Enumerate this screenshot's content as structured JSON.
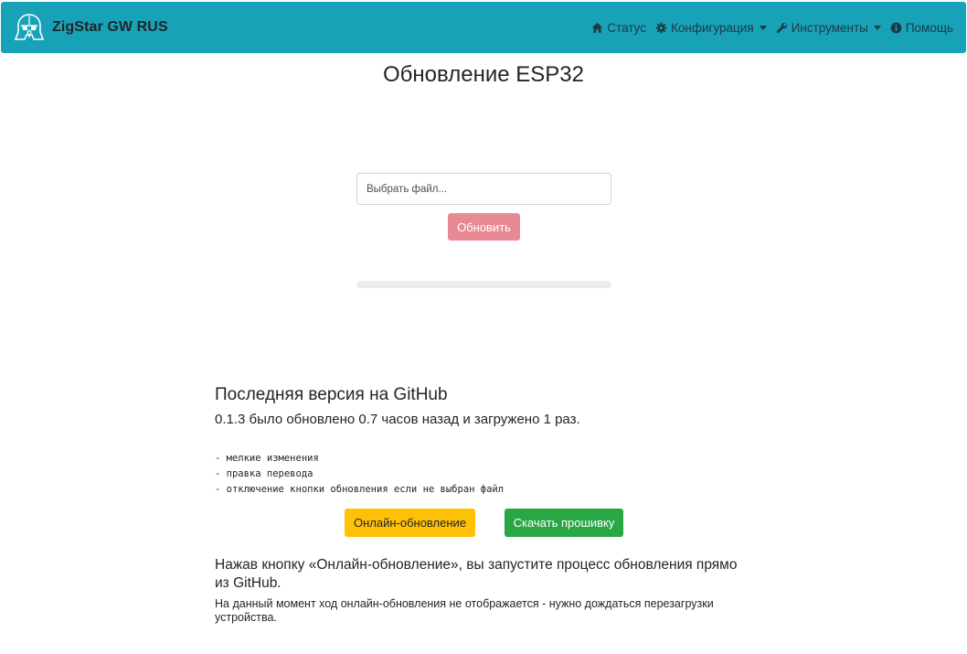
{
  "navbar": {
    "brand": "ZigStar GW RUS",
    "items": [
      {
        "label": "Статус",
        "icon": "home-icon",
        "dropdown": false
      },
      {
        "label": "Конфигурация",
        "icon": "gear-icon",
        "dropdown": true
      },
      {
        "label": "Инструменты",
        "icon": "wrench-icon",
        "dropdown": true
      },
      {
        "label": "Помощь",
        "icon": "info-icon",
        "dropdown": false
      }
    ]
  },
  "page": {
    "title": "Обновление ESP32"
  },
  "upload": {
    "file_placeholder": "Выбрать файл...",
    "update_button": "Обновить",
    "progress_percent": 0
  },
  "github": {
    "title": "Последняя версия на GitHub",
    "subtitle": "0.1.3 было обновлено 0.7 часов назад и загружено 1 раз.",
    "changelog": [
      "- мелкие изменения",
      "- правка перевода",
      "- отключение кнопки обновления если не выбран файл"
    ],
    "online_button": "Онлайн-обновление",
    "download_button": "Скачать прошивку",
    "note_title": "Нажав кнопку «Онлайн-обновление», вы запустите процесс обновления прямо из GitHub.",
    "note_text": "На данный момент ход онлайн-обновления не отображается - нужно дождаться перезагрузки устройства."
  },
  "colors": {
    "navbar": "#17a2b8",
    "update_button": "#e88a94",
    "online_button": "#ffc107",
    "download_button": "#28a745"
  }
}
